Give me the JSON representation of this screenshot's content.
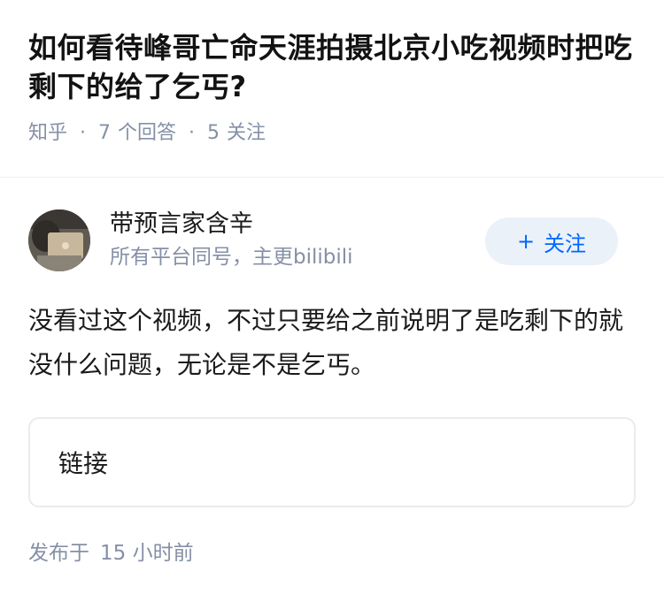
{
  "question": {
    "title": "如何看待峰哥亡命天涯拍摄北京小吃视频时把吃剩下的给了乞丐?",
    "source": "知乎",
    "answers_count": "7",
    "answers_label": "个回答",
    "follow_count": "5",
    "follow_label": "关注"
  },
  "answer": {
    "author": {
      "name": "带预言家含辛",
      "bio": "所有平台同号，主更bilibili",
      "avatar_icon": "avatar-photo"
    },
    "follow_button": {
      "icon": "+",
      "label": "关注",
      "color": "#0066ff",
      "bg": "#ebf1f9"
    },
    "content": "没看过这个视频，不过只要给之前说明了是吃剩下的就没什么问题，无论是不是乞丐。",
    "link_card_label": "链接",
    "published_prefix": "发布于",
    "published_time": "15 小时前"
  }
}
